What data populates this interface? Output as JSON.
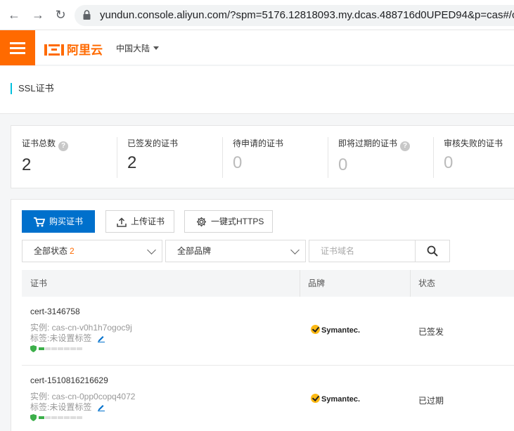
{
  "browser": {
    "url": "yundun.console.aliyun.com/?spm=5176.12818093.my.dcas.488716d0UPED94&p=cas#/c"
  },
  "topbar": {
    "logo_text": "阿里云",
    "region": "中国大陆"
  },
  "page": {
    "title": "SSL证书"
  },
  "stats": [
    {
      "label": "证书总数",
      "value": "2",
      "has_help": true
    },
    {
      "label": "已签发的证书",
      "value": "2",
      "has_help": false
    },
    {
      "label": "待申请的证书",
      "value": "0",
      "has_help": false
    },
    {
      "label": "即将过期的证书",
      "value": "0",
      "has_help": true
    },
    {
      "label": "审核失败的证书",
      "value": "0",
      "has_help": false
    }
  ],
  "toolbar": {
    "buy_label": "购买证书",
    "upload_label": "上传证书",
    "https_label": "一键式HTTPS"
  },
  "filters": {
    "status_label": "全部状态",
    "status_count": "2",
    "brand_label": "全部品牌",
    "domain_placeholder": "证书域名"
  },
  "table": {
    "columns": [
      "证书",
      "品牌",
      "状态"
    ],
    "rows": [
      {
        "name": "cert-3146758",
        "instance": "实例: cas-cn-v0h1h7ogoc9j",
        "tag": "标签:未设置标签",
        "brand": "Symantec.",
        "status": "已签发",
        "strength": 0.2
      },
      {
        "name": "cert-1510816216629",
        "instance": "实例: cas-cn-0pp0copq4072",
        "tag": "标签:未设置标签",
        "brand": "Symantec.",
        "status": "已过期",
        "strength": 0.2
      }
    ]
  },
  "colors": {
    "accent": "#ff6a00",
    "primary": "#0070cc",
    "title_bar": "#00c1de"
  }
}
